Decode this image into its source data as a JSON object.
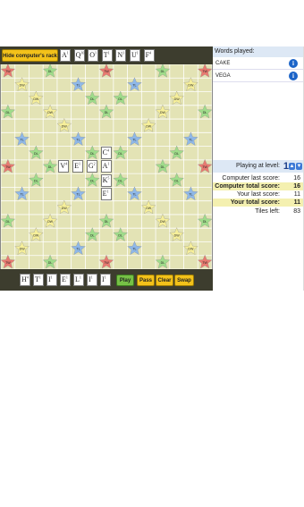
{
  "toolbar": {
    "hide_rack_label": "Hide computer's rack"
  },
  "computer_rack": [
    {
      "letter": "A",
      "score": "1"
    },
    {
      "letter": "Q",
      "score": "10"
    },
    {
      "letter": "O",
      "score": "1"
    },
    {
      "letter": "T",
      "score": "1"
    },
    {
      "letter": "N",
      "score": "1"
    },
    {
      "letter": "U",
      "score": "1"
    },
    {
      "letter": "F",
      "score": "4"
    }
  ],
  "player_rack": [
    {
      "letter": "H",
      "score": "4"
    },
    {
      "letter": "T",
      "score": "1"
    },
    {
      "letter": "I",
      "score": "1"
    },
    {
      "letter": "E",
      "score": "1"
    },
    {
      "letter": "L",
      "score": "1"
    },
    {
      "letter": "I",
      "score": "1"
    },
    {
      "letter": "I",
      "score": "1"
    }
  ],
  "controls": {
    "play": "Play",
    "pass": "Pass",
    "clear": "Clear",
    "swap": "Swap"
  },
  "board": {
    "premium": {
      "TW": "TW",
      "DW": "DW",
      "TL": "TL",
      "DL": "DL"
    },
    "tiles": [
      {
        "letter": "C",
        "score": "4",
        "row": 6,
        "col": 7
      },
      {
        "letter": "V",
        "score": "4",
        "row": 7,
        "col": 4
      },
      {
        "letter": "E",
        "score": "1",
        "row": 7,
        "col": 5
      },
      {
        "letter": "G",
        "score": "2",
        "row": 7,
        "col": 6
      },
      {
        "letter": "A",
        "score": "1",
        "row": 7,
        "col": 7
      },
      {
        "letter": "K",
        "score": "5",
        "row": 8,
        "col": 7
      },
      {
        "letter": "E",
        "score": "1",
        "row": 9,
        "col": 7
      }
    ]
  },
  "panel": {
    "words_header": "Words played:",
    "words": [
      "CAKE",
      "VEGA"
    ],
    "level_label": "Playing at level:",
    "level": "1",
    "scores": [
      {
        "label": "Computer last score:",
        "value": "16",
        "highlight": false,
        "bold": false
      },
      {
        "label": "Computer total score:",
        "value": "16",
        "highlight": true,
        "bold": true
      },
      {
        "label": "Your last score:",
        "value": "11",
        "highlight": false,
        "bold": false
      },
      {
        "label": "Your total score:",
        "value": "11",
        "highlight": true,
        "bold": true
      },
      {
        "label": "Tiles left:",
        "value": "83",
        "highlight": false,
        "bold": false
      }
    ]
  },
  "colors": {
    "TW": "#e87a70",
    "DW": "#f6ef9a",
    "TL": "#8fb8e8",
    "DL": "#9fdc8a",
    "board": "#e3e3b5",
    "bar": "#3d3d2e"
  }
}
